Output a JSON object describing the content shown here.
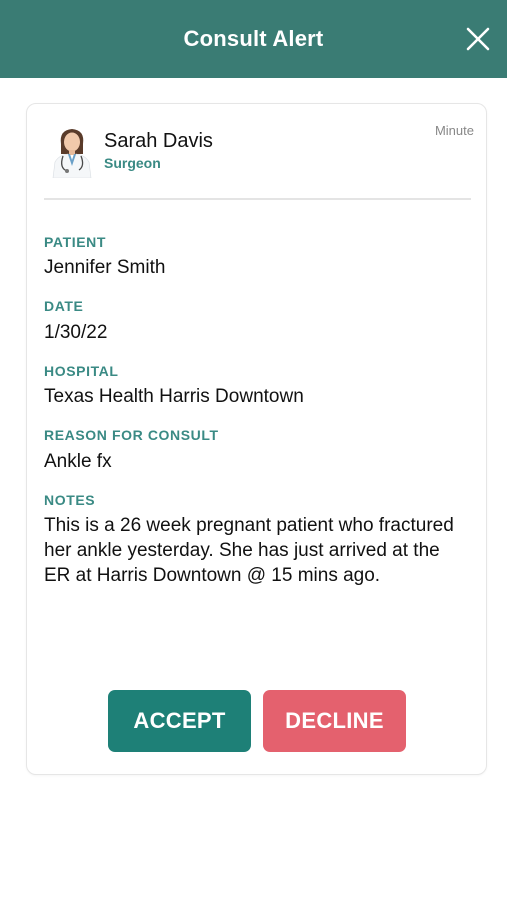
{
  "header": {
    "title": "Consult Alert",
    "close_icon": "close-icon"
  },
  "consult": {
    "user": {
      "name": "Sarah Davis",
      "role": "Surgeon",
      "timestamp": "Minute"
    },
    "fields": {
      "patient_label": "PATIENT",
      "patient": "Jennifer Smith",
      "date_label": "DATE",
      "date": "1/30/22",
      "hospital_label": "HOSPITAL",
      "hospital": "Texas Health Harris Downtown",
      "reason_label": "REASON FOR CONSULT",
      "reason": "Ankle fx",
      "notes_label": "NOTES",
      "notes": "This is a 26 week pregnant patient who fractured her ankle yesterday. She has just arrived at the ER at Harris Downtown @ 15 mins ago."
    },
    "actions": {
      "accept": "ACCEPT",
      "decline": "DECLINE"
    }
  },
  "colors": {
    "header": "#3a7c74",
    "accent": "#3a8a84",
    "accept": "#1e8077",
    "decline": "#e4616e"
  }
}
